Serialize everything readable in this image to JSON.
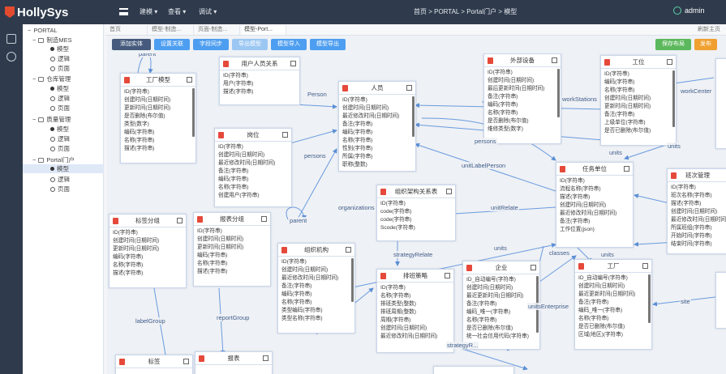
{
  "brand": {
    "name": "HollySys"
  },
  "topnav": [
    {
      "label": "建模 ▾"
    },
    {
      "label": "查看 ▾"
    },
    {
      "label": "调试 ▾"
    }
  ],
  "breadcrumb": "首页 > PORTAL > Portal门户 > 模型",
  "user": {
    "name": "admin"
  },
  "tree": {
    "root": "PORTAL",
    "groups": [
      {
        "label": "制造MES",
        "children": [
          "模型",
          "逻辑",
          "页面"
        ]
      },
      {
        "label": "仓库管理",
        "children": [
          "模型",
          "逻辑",
          "页面"
        ]
      },
      {
        "label": "质量管理",
        "children": [
          "模型",
          "逻辑",
          "页面"
        ]
      },
      {
        "label": "Portal门户",
        "children": [
          "模型",
          "逻辑",
          "页面"
        ]
      }
    ]
  },
  "tabs": [
    "首页",
    "模型-制造...",
    "页面-制造...",
    "模型-Port..."
  ],
  "tabs_more": "刷新主页",
  "toolbar": {
    "add_entity": "添加实体",
    "add_relation": "设置关联",
    "field_sync": "字段同步",
    "export": "导出模型",
    "model_import": "模型导入",
    "model_export": "模型导出",
    "save_layout": "保存布局",
    "publish": "发布"
  },
  "entities": [
    {
      "id": "factory",
      "title": "工厂模型",
      "fields": [
        "ID(字符串)",
        "创建时间(日期时间)",
        "更新时间(日期时间)",
        "是否删除(布尔值)",
        "类型(数字)",
        "编码(字符串)",
        "名称(字符串)",
        "描述(字符串)"
      ]
    },
    {
      "id": "usergroup",
      "title": "用户人员关系",
      "fields": [
        "ID(字符串)",
        "用户(字符串)",
        "描述(字符串)"
      ]
    },
    {
      "id": "person",
      "title": "人员",
      "fields": [
        "ID(字符串)",
        "创建时间(日期时间)",
        "最近修改时间(日期时间)",
        "备注(字符串)",
        "编码(字符串)",
        "名称(字符串)",
        "性别(字符串)",
        "所属(字符串)",
        "职称(整数)"
      ]
    },
    {
      "id": "position",
      "title": "岗位",
      "fields": [
        "ID(字符串)",
        "创建时间(日期时间)",
        "最近修改时间(日期时间)",
        "备注(字符串)",
        "编码(字符串)",
        "名称(字符串)",
        "创建用户(字符串)"
      ]
    },
    {
      "id": "outsource",
      "title": "外部设备",
      "fields": [
        "ID(字符串)",
        "创建时间(日期时间)",
        "最后更新时间(日期时间)",
        "备注(字符串)",
        "编码(字符串)",
        "名称(字符串)",
        "是否删除(布尔值)",
        "维修类型(数字)"
      ]
    },
    {
      "id": "workstation",
      "title": "工位",
      "fields": [
        "ID(字符串)",
        "编码(字符串)",
        "名称(字符串)",
        "创建时间(日期时间)",
        "更新时间(日期时间)",
        "备注(字符串)",
        "上级单位(字符串)",
        "是否已删除(布尔值)"
      ]
    },
    {
      "id": "orgrel",
      "title": "组织架构关系表",
      "fields": [
        "ID(字符串)",
        "code(字符串)",
        "code(字符串)",
        "Scode(字符串)"
      ]
    },
    {
      "id": "taskunit",
      "title": "任务单位",
      "fields": [
        "ID(字符串)",
        "流程名称(字符串)",
        "描述(字符串)",
        "创建时间(日期时间)",
        "最近修改时间(日期时间)",
        "备注(字符串)",
        "工作位置(json)"
      ]
    },
    {
      "id": "rightedge",
      "title": "班次管理",
      "fields": [
        "ID(字符串)",
        "班次名称(字符串)",
        "描述(字符串)",
        "创建时间(日期时间)",
        "最近修改时间(日期时间)",
        "所属班组(字符串)",
        "开始时间(字符串)",
        "结束时间(字符串)"
      ]
    },
    {
      "id": "labelcat",
      "title": "标签分组",
      "fields": [
        "ID(字符串)",
        "创建时间(日期时间)",
        "更新时间(日期时间)",
        "编码(字符串)",
        "名称(字符串)",
        "描述(字符串)"
      ]
    },
    {
      "id": "reportcat",
      "title": "报表分组",
      "fields": [
        "ID(字符串)",
        "创建时间(日期时间)",
        "更新时间(日期时间)",
        "编码(字符串)",
        "名称(字符串)",
        "描述(字符串)"
      ]
    },
    {
      "id": "org",
      "title": "组织机构",
      "fields": [
        "ID(字符串)",
        "创建时间(日期时间)",
        "最近修改时间(日期时间)",
        "备注(字符串)",
        "编码(字符串)",
        "名称(字符串)",
        "类型编码(字符串)",
        "类型名称(字符串)"
      ]
    },
    {
      "id": "strategy",
      "title": "排班策略",
      "fields": [
        "ID(字符串)",
        "名称(字符串)",
        "排班类型(整数)",
        "排班周期(整数)",
        "周期(字符串)",
        "创建时间(日期时间)",
        "最近修改时间(日期时间)"
      ]
    },
    {
      "id": "enterprise",
      "title": "企业",
      "fields": [
        "ID_自动编号(字符串)",
        "创建时间(日期时间)",
        "最近更新时间(日期时间)",
        "备注(字符串)",
        "编码_唯一(字符串)",
        "名称(字符串)",
        "是否已删除(布尔值)",
        "统一社会信用代码(字符串)"
      ]
    },
    {
      "id": "factory2",
      "title": "工厂",
      "fields": [
        "ID_自动编号(字符串)",
        "创建时间(日期时间)",
        "最近更新时间(日期时间)",
        "备注(字符串)",
        "编码_唯一(字符串)",
        "名称(字符串)",
        "是否已删除(布尔值)",
        "区域(地区)(字符串)"
      ]
    },
    {
      "id": "label",
      "title": "标签",
      "fields": []
    },
    {
      "id": "report",
      "title": "报表",
      "fields": []
    }
  ],
  "relations": [
    {
      "label": "parent"
    },
    {
      "label": "Person"
    },
    {
      "label": "persons"
    },
    {
      "label": "organizations"
    },
    {
      "label": "workStations"
    },
    {
      "label": "workCenter"
    },
    {
      "label": "units"
    },
    {
      "label": "unitLabelPerson"
    },
    {
      "label": "unitRelate"
    },
    {
      "label": "strategyRelate"
    },
    {
      "label": "parent"
    },
    {
      "label": "units"
    },
    {
      "label": "classes"
    },
    {
      "label": "units"
    },
    {
      "label": "unitsEnterprise"
    },
    {
      "label": "site"
    },
    {
      "label": "labelGroup"
    },
    {
      "label": "reportGroup"
    },
    {
      "label": "strategyR..."
    },
    {
      "label": "persons"
    },
    {
      "label": "units"
    }
  ]
}
